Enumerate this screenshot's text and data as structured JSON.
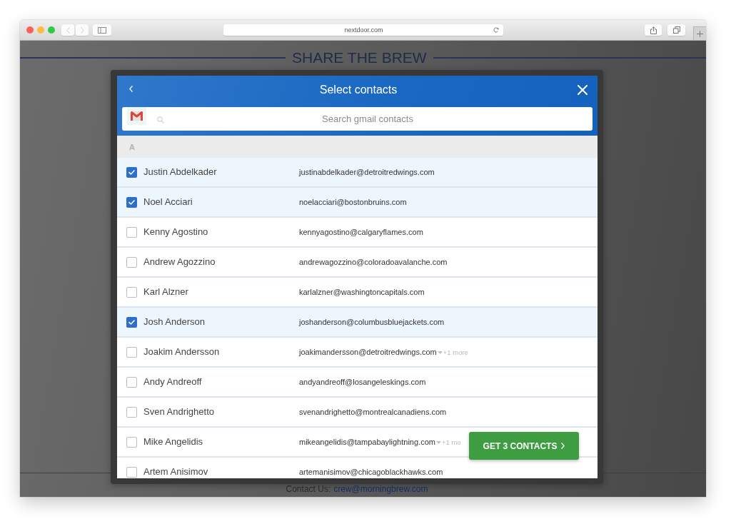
{
  "browser": {
    "url": "nextdoor.com"
  },
  "page": {
    "title": "SHARE THE BREW",
    "footer": {
      "label": "Contact Us:",
      "email": "crew@morningbrew.com"
    }
  },
  "modal": {
    "title": "Select contacts",
    "search": {
      "placeholder": "Search gmail contacts"
    },
    "section": "A",
    "contacts": [
      {
        "name": "Justin Abdelkader",
        "email": "justinabdelkader@detroitredwings.com",
        "checked": true
      },
      {
        "name": "Noel Acciari",
        "email": "noelacciari@bostonbruins.com",
        "checked": true
      },
      {
        "name": "Kenny Agostino",
        "email": "kennyagostino@calgaryflames.com",
        "checked": false
      },
      {
        "name": "Andrew Agozzino",
        "email": "andrewagozzino@coloradoavalanche.com",
        "checked": false
      },
      {
        "name": "Karl Alzner",
        "email": "karlalzner@washingtoncapitals.com",
        "checked": false
      },
      {
        "name": "Josh Anderson",
        "email": "joshanderson@columbusbluejackets.com",
        "checked": true
      },
      {
        "name": "Joakim Andersson",
        "email": "joakimandersson@detroitredwings.com",
        "checked": false,
        "more": "+1 more"
      },
      {
        "name": "Andy Andreoff",
        "email": "andyandreoff@losangeleskings.com",
        "checked": false
      },
      {
        "name": "Sven Andrighetto",
        "email": "svenandrighetto@montrealcanadiens.com",
        "checked": false
      },
      {
        "name": "Mike Angelidis",
        "email": "mikeangelidis@tampabaylightning.com",
        "checked": false,
        "more": "+1 mo"
      },
      {
        "name": "Artem Anisimov",
        "email": "artemanisimov@chicagoblackhawks.com",
        "checked": false
      }
    ],
    "action": {
      "label": "GET 3 CONTACTS"
    }
  }
}
